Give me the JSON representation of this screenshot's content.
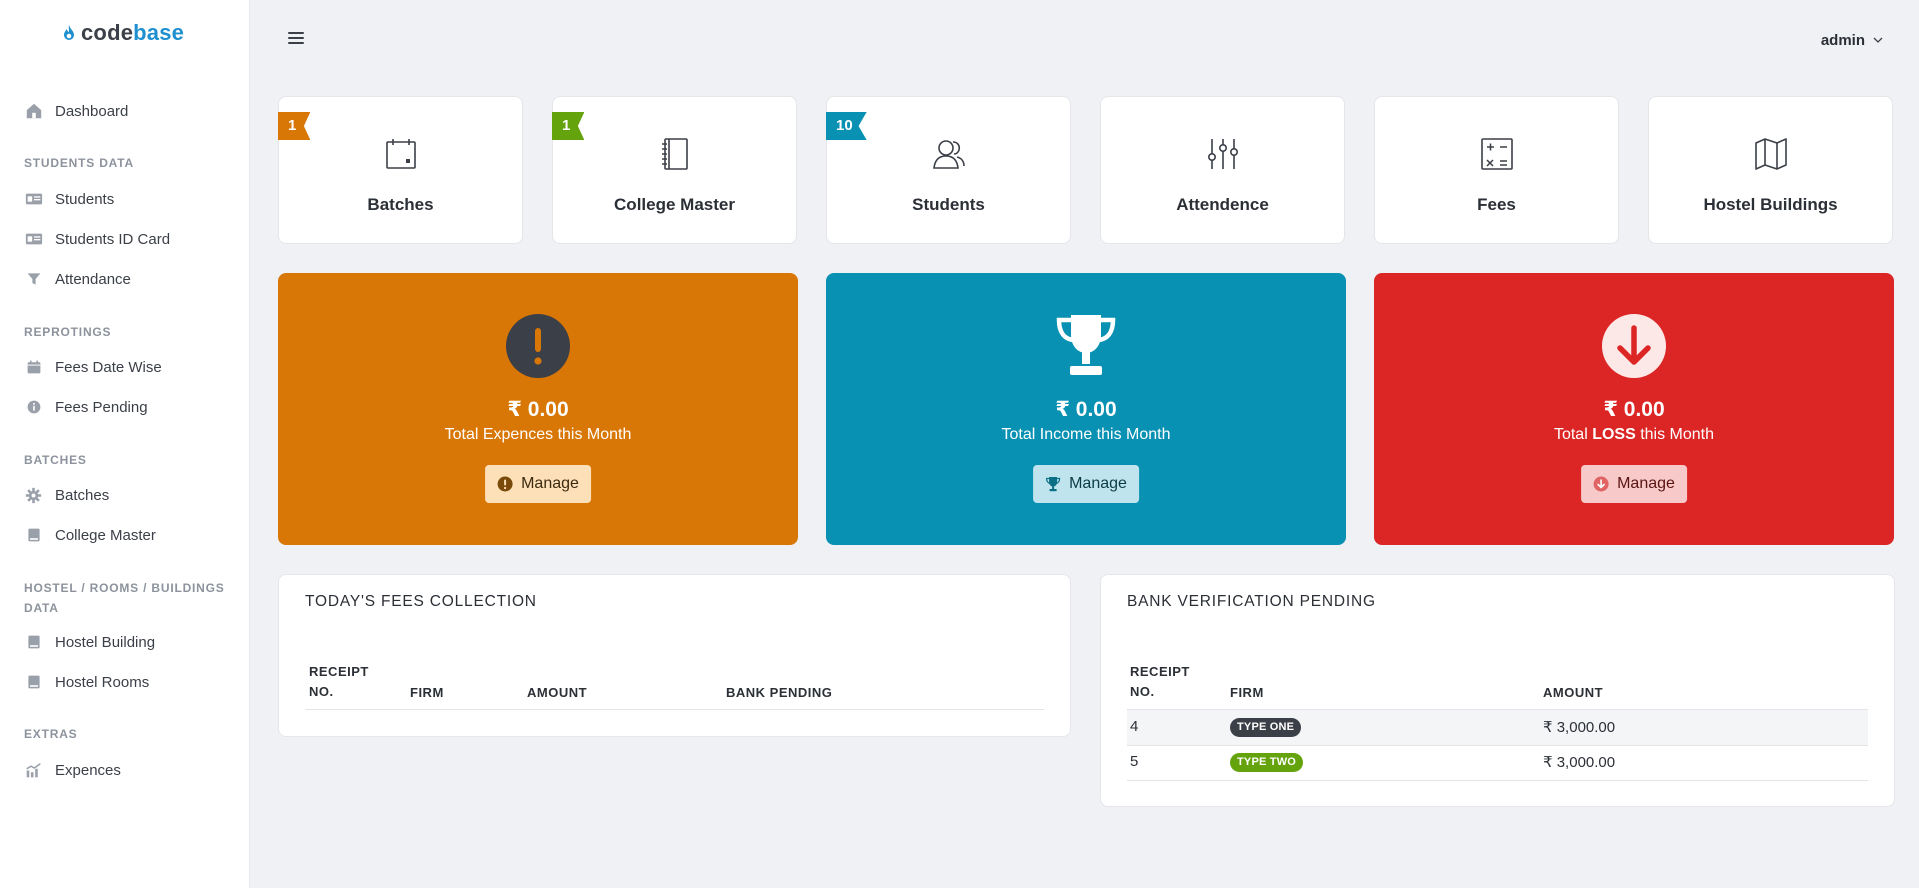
{
  "brand": {
    "part1": "code",
    "part2": "base"
  },
  "sidebar": {
    "dashboard": "Dashboard",
    "sections": [
      {
        "head": "STUDENTS DATA",
        "items": [
          "Students",
          "Students ID Card",
          "Attendance"
        ]
      },
      {
        "head": "REPROTINGS",
        "items": [
          "Fees Date Wise",
          "Fees Pending"
        ]
      },
      {
        "head": "BATCHES",
        "items": [
          "Batches",
          "College Master"
        ]
      },
      {
        "head": "HOSTEL / ROOMS / BUILDINGS DATA",
        "items": [
          "Hostel Building",
          "Hostel Rooms"
        ]
      },
      {
        "head": "EXTRAS",
        "items": [
          "Expences"
        ]
      }
    ]
  },
  "topbar": {
    "user": "admin"
  },
  "tiles": [
    {
      "label": "Batches",
      "count": "1",
      "color": "#d97706",
      "icon": "calendar-icon"
    },
    {
      "label": "College Master",
      "count": "1",
      "color": "#65a30d",
      "icon": "notebook-icon"
    },
    {
      "label": "Students",
      "count": "10",
      "color": "#0891b2",
      "icon": "users-icon"
    },
    {
      "label": "Attendence",
      "count": "",
      "color": "",
      "icon": "sliders-icon"
    },
    {
      "label": "Fees",
      "count": "",
      "color": "",
      "icon": "calculator-icon"
    },
    {
      "label": "Hostel Buildings",
      "count": "",
      "color": "",
      "icon": "map-icon"
    }
  ],
  "cards": [
    {
      "amount": "₹ 0.00",
      "desc_pre": "Total Expences this Month",
      "desc_bold": "",
      "desc_post": "",
      "button": "Manage",
      "color": "#d97706",
      "icon": "exclamation-icon"
    },
    {
      "amount": "₹ 0.00",
      "desc_pre": "Total Income this Month",
      "desc_bold": "",
      "desc_post": "",
      "button": "Manage",
      "color": "#0891b2",
      "icon": "trophy-icon"
    },
    {
      "amount": "₹ 0.00",
      "desc_pre": "Total ",
      "desc_bold": "LOSS",
      "desc_post": " this Month",
      "button": "Manage",
      "color": "#dc2626",
      "icon": "arrow-down-icon"
    }
  ],
  "fees_panel": {
    "title": "TODAY'S FEES COLLECTION",
    "columns": [
      "RECEIPT NO.",
      "FIRM",
      "AMOUNT",
      "BANK PENDING"
    ],
    "rows": []
  },
  "bank_panel": {
    "title": "BANK VERIFICATION PENDING",
    "columns": [
      "RECEIPT NO.",
      "FIRM",
      "AMOUNT"
    ],
    "rows": [
      {
        "receipt": "4",
        "firm": "TYPE ONE",
        "firm_color": "#3b3f47",
        "amount": "₹ 3,000.00"
      },
      {
        "receipt": "5",
        "firm": "TYPE TWO",
        "firm_color": "#65a30d",
        "amount": "₹ 3,000.00"
      }
    ]
  }
}
